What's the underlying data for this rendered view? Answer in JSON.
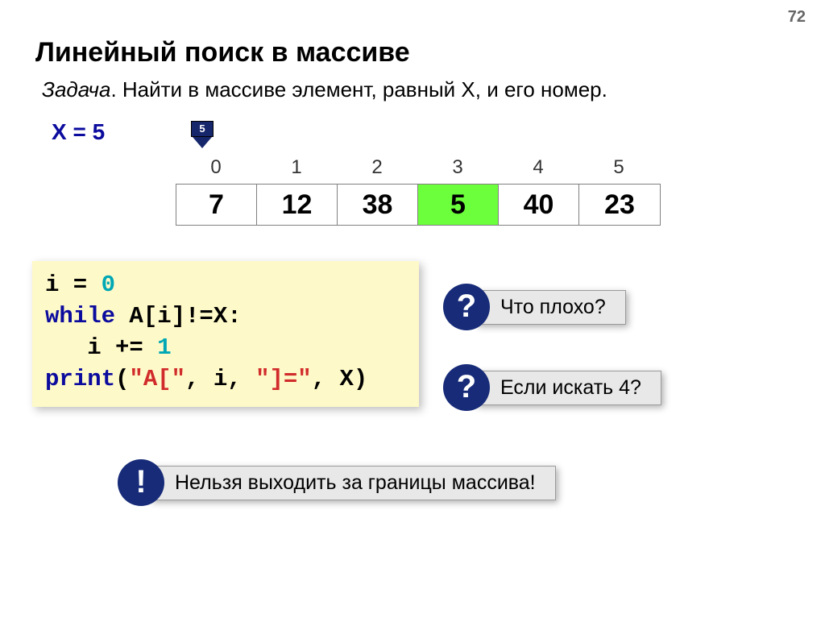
{
  "page_number": "72",
  "title": "Линейный поиск в массиве",
  "task": {
    "label": "Задача",
    "text": ". Найти в массиве элемент, равный X, и его номер."
  },
  "x_eq": "X = 5",
  "pointer_value": "5",
  "array": {
    "indices": [
      "0",
      "1",
      "2",
      "3",
      "4",
      "5"
    ],
    "values": [
      "7",
      "12",
      "38",
      "5",
      "40",
      "23"
    ],
    "highlight_index": 3
  },
  "code": {
    "l1a": "i = ",
    "l1b": "0",
    "l2a": "while",
    "l2b": " A[i]!=X:",
    "l3a": "   i += ",
    "l3b": "1",
    "l4a": "print",
    "l4b": "(",
    "l4c": "\"A[\"",
    "l4d": ", i, ",
    "l4e": "\"]=\"",
    "l4f": ", X)"
  },
  "callouts": {
    "q1": {
      "icon": "?",
      "text": "Что плохо?"
    },
    "q2": {
      "icon": "?",
      "text": "Если искать 4?"
    },
    "w1": {
      "icon": "!",
      "text": "Нельзя выходить за границы массива!"
    }
  }
}
